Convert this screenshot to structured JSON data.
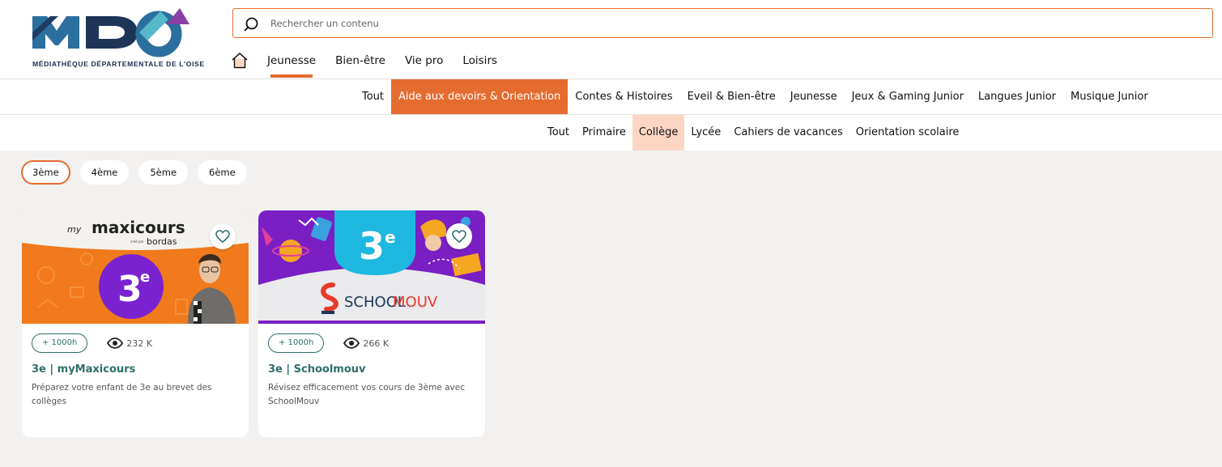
{
  "logo": {
    "letters": "MDO",
    "subtitle": "MÉDIATHÈQUE DÉPARTEMENTALE DE L'OISE"
  },
  "search": {
    "placeholder": "Rechercher un contenu"
  },
  "main_nav": {
    "items": [
      "Jeunesse",
      "Bien-être",
      "Vie pro",
      "Loisirs"
    ],
    "active": "Jeunesse"
  },
  "categories": {
    "items": [
      "Tout",
      "Aide aux devoirs & Orientation",
      "Contes & Histoires",
      "Eveil & Bien-être",
      "Jeunesse",
      "Jeux & Gaming Junior",
      "Langues Junior",
      "Musique Junior"
    ],
    "active": "Aide aux devoirs & Orientation"
  },
  "subcategories": {
    "items": [
      "Tout",
      "Primaire",
      "Collège",
      "Lycée",
      "Cahiers de vacances",
      "Orientation scolaire"
    ],
    "active": "Collège"
  },
  "chips": {
    "items": [
      "3ème",
      "4ème",
      "5ème",
      "6ème"
    ],
    "active": "3ème"
  },
  "cards": [
    {
      "title": "3e | myMaxicours",
      "description": "Préparez votre enfant de 3e au brevet des collèges",
      "duration_badge": "+ 1000h",
      "views": "232 K",
      "image": {
        "brand_prefix": "my",
        "brand": "maxicours",
        "brand_sub": "créé par",
        "brand_sub2": "bordas",
        "grade": "3",
        "grade_sup": "e",
        "bg_color": "#f07a1c",
        "circle_color": "#7a22d0"
      }
    },
    {
      "title": "3e | Schoolmouv",
      "description": "Révisez efficacement vos cours de 3ème avec SchoolMouv",
      "duration_badge": "+ 1000h",
      "views": "266 K",
      "image": {
        "grade": "3",
        "grade_sup": "e",
        "brand_a": "SCHOOL",
        "brand_b": "MOUV",
        "bg_color": "#7a1fc4",
        "tab_color": "#1eb7e0"
      }
    }
  ],
  "colors": {
    "accent": "#e56c2f",
    "accent_light": "#fcd6c3",
    "teal": "#2f6f6a",
    "page_bg": "#f2f1ef"
  }
}
